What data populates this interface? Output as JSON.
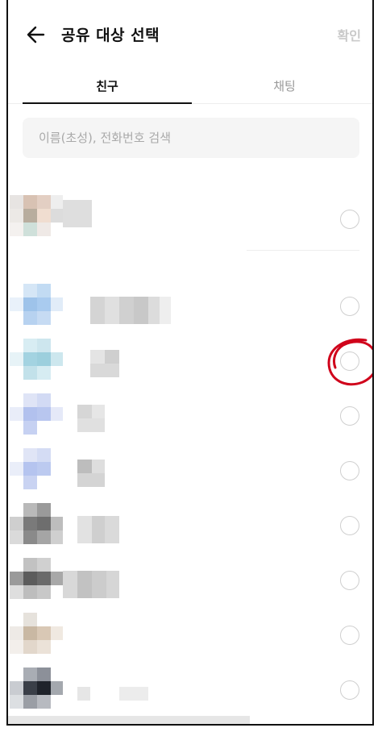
{
  "header": {
    "title": "공유 대상 선택",
    "confirm_label": "확인"
  },
  "tabs": [
    {
      "label": "친구",
      "active": true
    },
    {
      "label": "채팅",
      "active": false
    }
  ],
  "search": {
    "placeholder": "이름(초성), 전화번호 검색",
    "value": ""
  },
  "colors": {
    "accent_text": "#111111",
    "inactive_tab": "#9a9a9a",
    "confirm_disabled": "#c9c9c9",
    "annotation": "#d0021b"
  },
  "friends": [
    {
      "selected": false
    },
    {
      "selected": false
    },
    {
      "selected": false
    },
    {
      "selected": false
    },
    {
      "selected": false
    },
    {
      "selected": false
    },
    {
      "selected": false
    },
    {
      "selected": false
    },
    {
      "selected": false
    }
  ]
}
